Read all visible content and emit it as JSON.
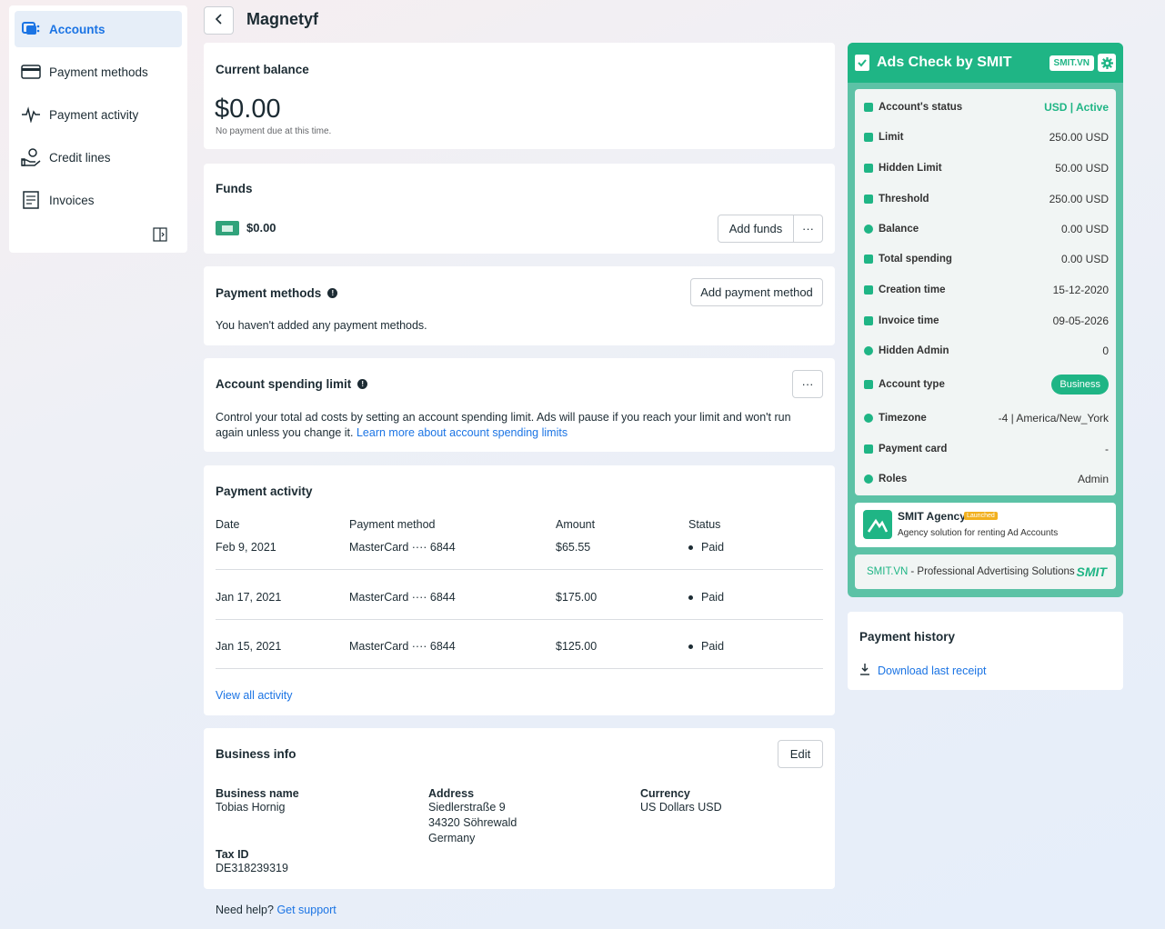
{
  "sidebar": {
    "items": [
      {
        "label": "Accounts",
        "icon": "accounts-icon"
      },
      {
        "label": "Payment methods",
        "icon": "credit-card-icon"
      },
      {
        "label": "Payment activity",
        "icon": "pulse-icon"
      },
      {
        "label": "Credit lines",
        "icon": "hand-coin-icon"
      },
      {
        "label": "Invoices",
        "icon": "document-icon"
      }
    ]
  },
  "header": {
    "title": "Magnetyf"
  },
  "balance": {
    "title": "Current balance",
    "amount": "$0.00",
    "note": "No payment due at this time."
  },
  "funds": {
    "title": "Funds",
    "amount": "$0.00",
    "add_label": "Add funds",
    "more_label": "···"
  },
  "payment_methods": {
    "title": "Payment methods",
    "add_label": "Add payment method",
    "empty_text": "You haven't added any payment methods."
  },
  "spending_limit": {
    "title": "Account spending limit",
    "more_label": "···",
    "text": "Control your total ad costs by setting an account spending limit. Ads will pause if you reach your limit and won't run again unless you change it.",
    "link": "Learn more about account spending limits"
  },
  "activity": {
    "title": "Payment activity",
    "columns": [
      "Date",
      "Payment method",
      "Amount",
      "Status"
    ],
    "rows": [
      {
        "date": "Feb 9, 2021",
        "method": "MasterCard ···· 6844",
        "amount": "$65.55",
        "status": "Paid"
      },
      {
        "date": "Jan 17, 2021",
        "method": "MasterCard ···· 6844",
        "amount": "$175.00",
        "status": "Paid"
      },
      {
        "date": "Jan 15, 2021",
        "method": "MasterCard ···· 6844",
        "amount": "$125.00",
        "status": "Paid"
      }
    ],
    "view_all": "View all activity"
  },
  "business": {
    "title": "Business info",
    "edit_label": "Edit",
    "name_label": "Business name",
    "name": "Tobias Hornig",
    "address_label": "Address",
    "address": [
      "Siedlerstraße 9",
      "34320 Söhrewald",
      "Germany"
    ],
    "currency_label": "Currency",
    "currency": "US Dollars USD",
    "tax_label": "Tax ID",
    "tax": "DE318239319"
  },
  "help": {
    "text": "Need help?",
    "link": "Get support"
  },
  "smit": {
    "title": "Ads Check by SMIT",
    "tag": "SMIT.VN",
    "accent": "#1fb585",
    "rows": [
      {
        "label": "Account's status",
        "value": "USD | Active"
      },
      {
        "label": "Limit",
        "value": "250.00 USD"
      },
      {
        "label": "Hidden Limit",
        "value": "50.00 USD"
      },
      {
        "label": "Threshold",
        "value": "250.00 USD"
      },
      {
        "label": "Balance",
        "value": "0.00 USD"
      },
      {
        "label": "Total spending",
        "value": "0.00 USD"
      },
      {
        "label": "Creation time",
        "value": "15-12-2020"
      },
      {
        "label": "Invoice time",
        "value": "09-05-2026"
      },
      {
        "label": "Hidden Admin",
        "value": "0"
      },
      {
        "label": "Account type",
        "value": "Business"
      },
      {
        "label": "Timezone",
        "value": "-4 | America/New_York"
      },
      {
        "label": "Payment card",
        "value": "-"
      },
      {
        "label": "Roles",
        "value": "Admin"
      }
    ],
    "agency_name": "SMIT Agency",
    "agency_badge": "Launched",
    "agency_desc": "Agency solution for renting Ad Accounts",
    "footer_brand": "SMIT.VN",
    "footer_text": "- Professional Advertising Solutions",
    "footer_logo": "SMIT"
  },
  "payment_history": {
    "title": "Payment history",
    "link": "Download last receipt"
  }
}
